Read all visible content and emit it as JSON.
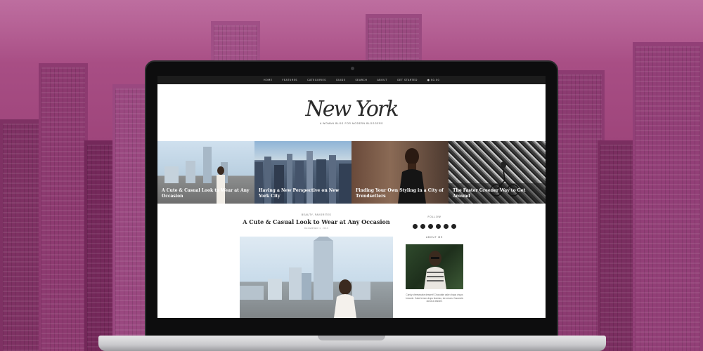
{
  "colors": {
    "background_tint": "#a2497f",
    "nav_bar": "#1c1c1c",
    "screen_bg": "#ffffff"
  },
  "nav": {
    "items": [
      "HOME",
      "FEATURES",
      "CATEGORIES",
      "GUIDE",
      "SEARCH",
      "ABOUT",
      "GET STARTED",
      "$0.00"
    ],
    "cart_icon": "cart-icon"
  },
  "masthead": {
    "logo": "New York",
    "tagline": "A WOMAN BLOG FOR MODERN BLOGGERS"
  },
  "slider": {
    "slides": [
      {
        "caption": "A Cute & Casual Look to Wear at Any Occasion"
      },
      {
        "caption": "Having a New Perspective on New York City"
      },
      {
        "caption": "Finding Your Own Styling in a City of Trendsetters"
      },
      {
        "caption": "The Faster Greener Way to Get Around"
      }
    ]
  },
  "post": {
    "category": "BEAUTY, FAVORITES",
    "title": "A Cute & Casual Look to Wear at Any Occasion",
    "date": "DECEMBER 1, 2016"
  },
  "sidebar": {
    "follow_heading": "FOLLOW",
    "social_icons": [
      "facebook-icon",
      "twitter-icon",
      "pinterest-icon",
      "instagram-icon",
      "bloglovin-icon",
      "email-icon"
    ],
    "about_heading": "ABOUT ME",
    "about_text": "Candy cheesecake dessert! Chocolate cake chupa chups brownie. Cake lemon drops tiramisu, ice cream. Caramels donut a dessert."
  }
}
